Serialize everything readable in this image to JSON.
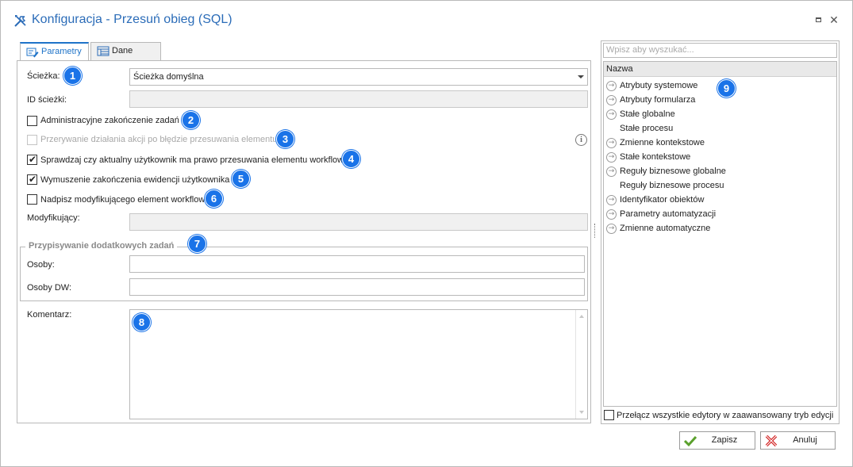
{
  "window": {
    "title": "Konfiguracja - Przesuń obieg (SQL)"
  },
  "tabs": [
    {
      "label": "Parametry",
      "active": true
    },
    {
      "label": "Dane",
      "active": false
    }
  ],
  "form": {
    "path_label": "Ścieżka:",
    "path_value": "Ścieżka domyślna",
    "path_id_label": "ID ścieżki:",
    "path_id_value": "",
    "modifier_label": "Modyfikujący:",
    "modifier_value": "",
    "comment_label": "Komentarz:",
    "comment_value": ""
  },
  "checkboxes": [
    {
      "label": "Administracyjne zakończenie zadań",
      "checked": false,
      "disabled": false
    },
    {
      "label": "Przerywanie działania akcji po błędzie przesuwania elementu",
      "checked": false,
      "disabled": true
    },
    {
      "label": "Sprawdzaj czy aktualny użytkownik ma prawo przesuwania elementu workflow",
      "checked": true,
      "disabled": false
    },
    {
      "label": "Wymuszenie zakończenia ewidencji użytkownika",
      "checked": true,
      "disabled": false
    },
    {
      "label": "Nadpisz modyfikującego element workflow",
      "checked": false,
      "disabled": false
    }
  ],
  "group": {
    "title": "Przypisywanie dodatkowych zadań",
    "persons_label": "Osoby:",
    "persons_value": "",
    "persons_dw_label": "Osoby DW:",
    "persons_dw_value": ""
  },
  "badges": [
    "1",
    "2",
    "3",
    "4",
    "5",
    "6",
    "7",
    "8",
    "9"
  ],
  "info_icon": "info-icon",
  "right_panel": {
    "search_placeholder": "Wpisz aby wyszukać...",
    "tree_header": "Nazwa",
    "items": [
      {
        "label": "Atrybuty systemowe",
        "expandable": true
      },
      {
        "label": "Atrybuty formularza",
        "expandable": true
      },
      {
        "label": "Stałe globalne",
        "expandable": true
      },
      {
        "label": "Stałe procesu",
        "expandable": false
      },
      {
        "label": "Zmienne kontekstowe",
        "expandable": true
      },
      {
        "label": "Stałe kontekstowe",
        "expandable": true
      },
      {
        "label": "Reguły biznesowe globalne",
        "expandable": true
      },
      {
        "label": "Reguły biznesowe procesu",
        "expandable": false
      },
      {
        "label": "Identyfikator obiektów",
        "expandable": true
      },
      {
        "label": "Parametry automatyzacji",
        "expandable": true
      },
      {
        "label": "Zmienne automatyczne",
        "expandable": true
      }
    ],
    "advanced_toggle_label": "Przełącz wszystkie edytory w zaawansowany tryb edycji",
    "advanced_toggle_checked": false
  },
  "buttons": {
    "save": "Zapisz",
    "cancel": "Anuluj"
  },
  "colors": {
    "accent": "#1e73c8",
    "badge": "#1a73e8",
    "title": "#2b6cb8",
    "save_icon": "#5aa02c",
    "cancel_icon": "#d42a2a"
  }
}
